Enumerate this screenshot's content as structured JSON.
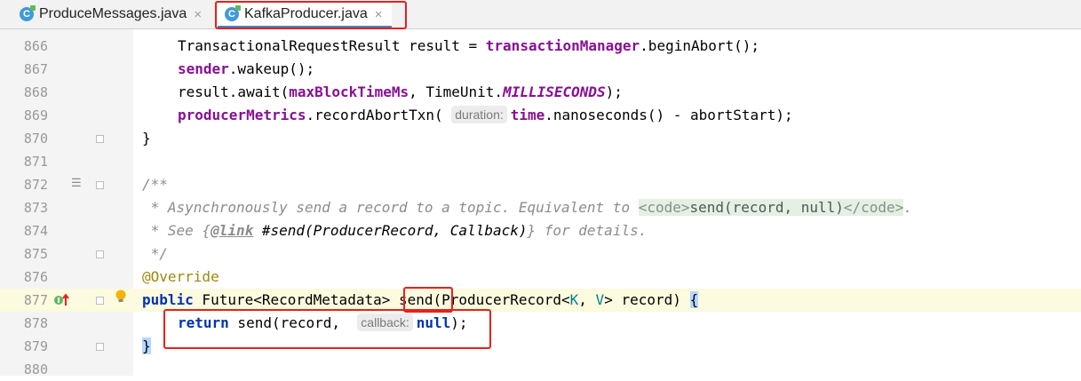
{
  "tabs": [
    {
      "label": "ProduceMessages.java",
      "icon": "java-class-icon",
      "active": false
    },
    {
      "label": "KafkaProducer.java",
      "icon": "java-class-icon",
      "active": true
    }
  ],
  "close_glyph": "×",
  "lines": [
    {
      "num": "866"
    },
    {
      "num": "867"
    },
    {
      "num": "868"
    },
    {
      "num": "869"
    },
    {
      "num": "870"
    },
    {
      "num": "871"
    },
    {
      "num": "872"
    },
    {
      "num": "873"
    },
    {
      "num": "874"
    },
    {
      "num": "875"
    },
    {
      "num": "876"
    },
    {
      "num": "877"
    },
    {
      "num": "878"
    },
    {
      "num": "879"
    },
    {
      "num": "880"
    }
  ],
  "code": {
    "l866_a": "TransactionalRequestResult result = ",
    "l866_b": "transactionManager",
    "l866_c": ".beginAbort();",
    "l867_a": "sender",
    "l867_b": ".wakeup();",
    "l868_a": "result.await(",
    "l868_b": "maxBlockTimeMs",
    "l868_c": ", TimeUnit.",
    "l868_d": "MILLISECONDS",
    "l868_e": ");",
    "l869_a": "producerMetrics",
    "l869_b": ".recordAbortTxn(",
    "l869_hint": "duration:",
    "l869_c": "time",
    "l869_d": ".nanoseconds() - abortStart);",
    "l870": "}",
    "l872": "/**",
    "l873_a": " * Asynchronously send a record to a topic. Equivalent to ",
    "l873_b": "<code>",
    "l873_c": "send(record, null)",
    "l873_d": "</code>",
    "l873_e": ".",
    "l874_a": " * See {",
    "l874_b": "@link",
    "l874_c": " #send(ProducerRecord, Callback)",
    "l874_d": "} for details.",
    "l875": " */",
    "l876": "@Override",
    "l877_a": "public",
    "l877_b": " Future<RecordMetadata> ",
    "l877_c": "send",
    "l877_d": "(ProducerRecord<",
    "l877_e": "K",
    "l877_f": ", ",
    "l877_g": "V",
    "l877_h": "> record) ",
    "l877_i": "{",
    "l878_a": "return",
    "l878_b": " send(record, ",
    "l878_hint": "callback:",
    "l878_c": "null",
    "l878_d": ");",
    "l879": "}"
  },
  "colors": {
    "keyword": "#0033b3",
    "field": "#871094",
    "comment": "#8c8c8c",
    "annotation": "#9e880d",
    "highlight": "#e5211d"
  }
}
